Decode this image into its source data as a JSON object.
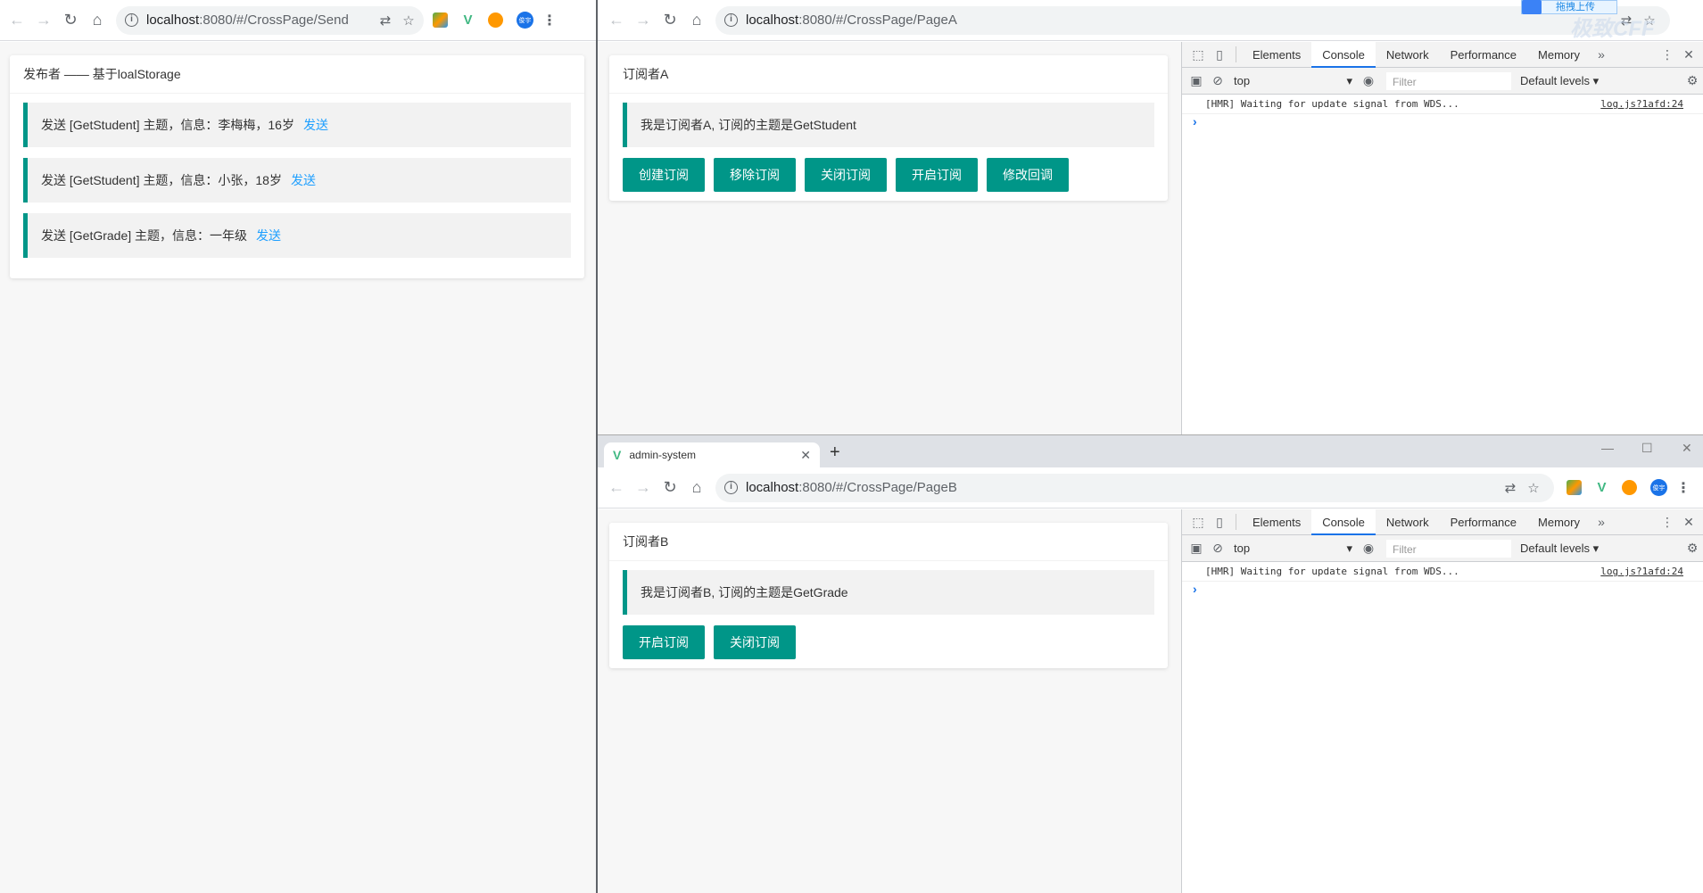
{
  "publisher_window": {
    "url_host": "localhost",
    "url_rest": ":8080/#/CrossPage/Send",
    "profile_label": "俊宇",
    "card_title": "发布者 —— 基于loalStorage",
    "messages": [
      {
        "text": "发送 [GetStudent] 主题，信息：李梅梅，16岁",
        "action": "发送"
      },
      {
        "text": "发送 [GetStudent] 主题，信息：小张，18岁",
        "action": "发送"
      },
      {
        "text": "发送 [GetGrade] 主题，信息：一年级",
        "action": "发送"
      }
    ]
  },
  "subscriber_a": {
    "url_host": "localhost",
    "url_rest": ":8080/#/CrossPage/PageA",
    "card_title": "订阅者A",
    "quote": "我是订阅者A, 订阅的主题是GetStudent",
    "buttons": [
      "创建订阅",
      "移除订阅",
      "关闭订阅",
      "开启订阅",
      "修改回调"
    ]
  },
  "subscriber_b": {
    "tab_title": "admin-system",
    "url_host": "localhost",
    "url_rest": ":8080/#/CrossPage/PageB",
    "profile_label": "俊宇",
    "card_title": "订阅者B",
    "quote": "我是订阅者B, 订阅的主题是GetGrade",
    "buttons": [
      "开启订阅",
      "关闭订阅"
    ]
  },
  "devtools": {
    "tabs": [
      "Elements",
      "Console",
      "Network",
      "Performance",
      "Memory"
    ],
    "active_tab": "Console",
    "context": "top",
    "filter_placeholder": "Filter",
    "levels": "Default levels",
    "log_message": "[HMR] Waiting for update signal from WDS...",
    "log_source": "log.js?1afd:24"
  },
  "overlay": {
    "upload_label": "拖拽上传",
    "watermark": "极致CFF"
  },
  "colors": {
    "primary": "#009688",
    "link": "#1e9fff",
    "quote_bg": "#f2f2f2",
    "page_bg": "#f7f7f7"
  }
}
